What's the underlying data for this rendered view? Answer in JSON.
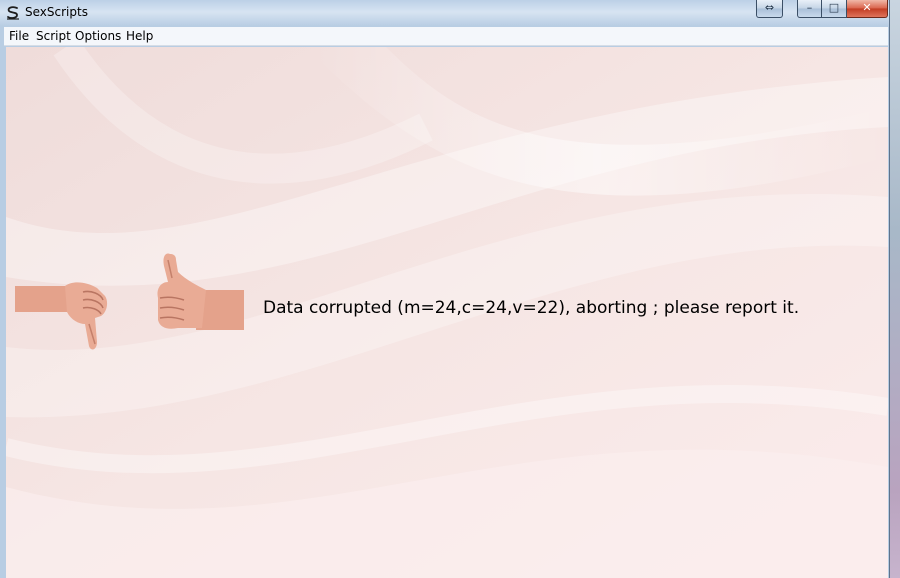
{
  "window": {
    "title": "SexScripts",
    "close_glyph": "✕",
    "minimize_glyph": "–",
    "maximize_glyph": "□",
    "extra_glyph": "⇔"
  },
  "menu": {
    "items": [
      "File",
      "Script",
      "Options",
      "Help"
    ]
  },
  "content": {
    "message": "Data corrupted (m=24,c=24,v=22), aborting ; please report it.",
    "left_image": "thumbs-down-hand",
    "right_image": "thumbs-up-hand"
  },
  "colors": {
    "background": "#f5e2e0",
    "swirl": "#ffffff",
    "skin": "#e8a48e"
  }
}
